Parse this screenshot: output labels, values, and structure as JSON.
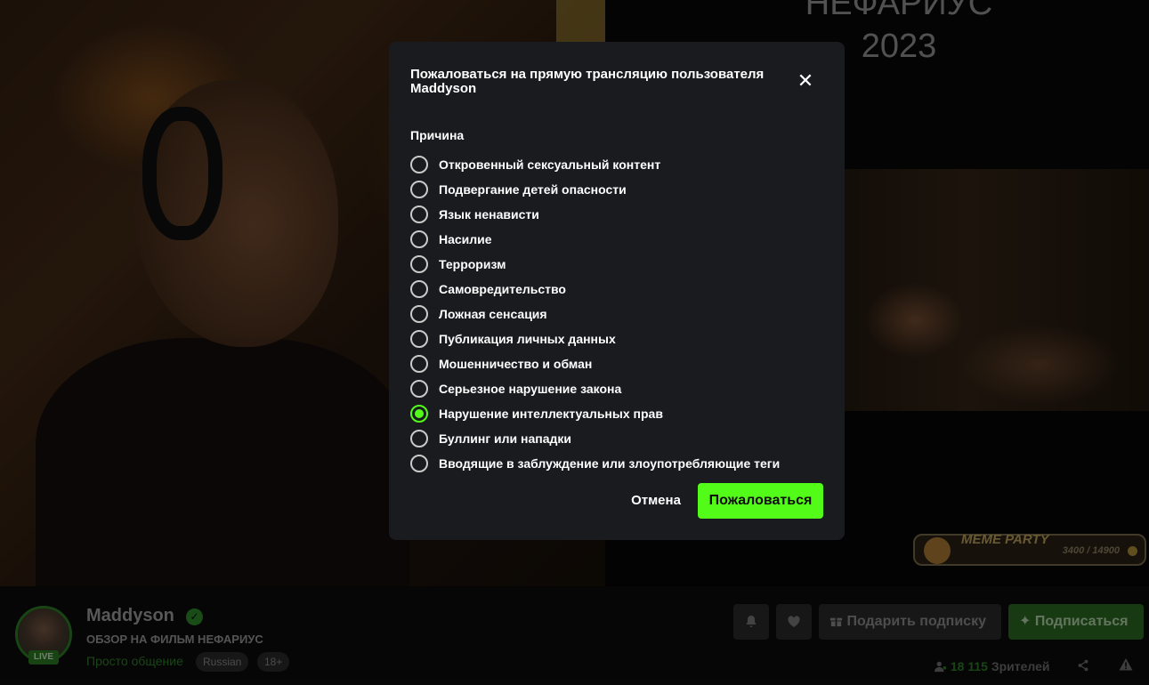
{
  "video": {
    "movie_title_line1": "НЕФАРИУС",
    "movie_title_line2": "2023",
    "meme_widget": {
      "label": "MEME PARTY",
      "count": "3400 / 14900"
    }
  },
  "streamer": {
    "name": "Maddyson",
    "live_badge": "LIVE",
    "stream_title": "ОБЗОР НА ФИЛЬМ НЕФАРИУС",
    "category": "Просто общение",
    "tags": [
      "Russian",
      "18+"
    ]
  },
  "actions": {
    "gift_label": "Подарить подписку",
    "subscribe_label": "Подписаться",
    "viewers_count": "18 115",
    "viewers_label": "Зрителей"
  },
  "modal": {
    "title": "Пожаловаться на прямую трансляцию пользователя Maddyson",
    "close_glyph": "✕",
    "reason_heading": "Причина",
    "options": [
      "Откровенный сексуальный контент",
      "Подвергание детей опасности",
      "Язык ненависти",
      "Насилие",
      "Терроризм",
      "Самовредительство",
      "Ложная сенсация",
      "Публикация личных данных",
      "Мошенничество и обман",
      "Серьезное нарушение закона",
      "Нарушение интеллектуальных прав",
      "Буллинг или нападки",
      "Вводящие в заблуждение или злоупотребляющие теги"
    ],
    "selected_index": 10,
    "cancel_label": "Отмена",
    "submit_label": "Пожаловаться"
  },
  "colors": {
    "accent": "#53fc18",
    "modal_bg": "#191b1f",
    "brand_dim": "#2f7f27"
  },
  "icons": {
    "bell": "bell-icon",
    "heart": "heart-icon",
    "gift": "gift-icon",
    "sparkle": "sparkle-icon",
    "viewers": "viewers-icon",
    "share": "share-icon",
    "report": "report-icon",
    "verified": "verified-icon",
    "close": "close-icon"
  }
}
